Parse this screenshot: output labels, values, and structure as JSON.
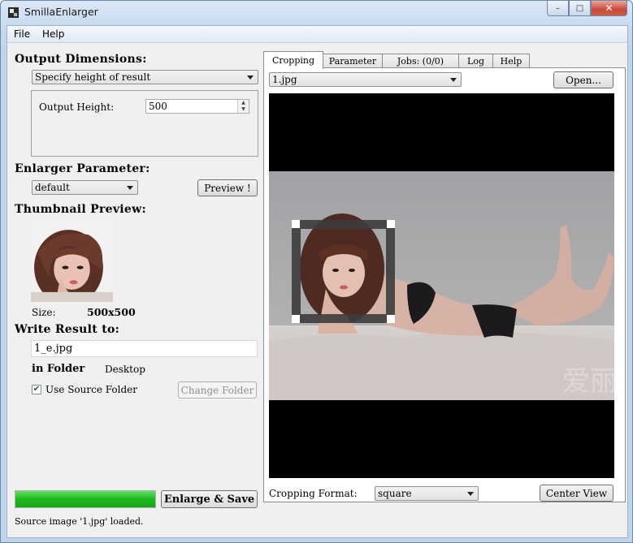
{
  "window": {
    "title": "SmillaEnlarger",
    "min_glyph": "–",
    "max_glyph": "□",
    "close_glyph": "✕"
  },
  "menu": [
    "File",
    "Help"
  ],
  "left": {
    "output_dimensions_label": "Output Dimensions:",
    "dimension_mode": "Specify height of result",
    "output_height_label": "Output Height:",
    "output_height_value": "500",
    "enlarger_parameter_label": "Enlarger Parameter:",
    "parameter_preset": "default",
    "preview_button": "Preview !",
    "thumbnail_label": "Thumbnail Preview:",
    "size_label": "Size:",
    "size_value": "500x500",
    "write_result_label": "Write Result to:",
    "output_filename": "1_e.jpg",
    "in_folder_label": "in Folder",
    "folder_value": "Desktop",
    "use_source_folder_label": "Use Source Folder",
    "use_source_folder_checked": true,
    "change_folder_button": "Change Folder",
    "progress_fraction": 1.0,
    "enlarge_save_button": "Enlarge & Save",
    "status_text": "Source image '1.jpg' loaded."
  },
  "right": {
    "tabs": [
      "Cropping",
      "Parameter",
      "Jobs: (0/0)",
      "Log",
      "Help"
    ],
    "active_tab": "Cropping",
    "source_file": "1.jpg",
    "open_button": "Open...",
    "watermark": "爱丽",
    "cropping_format_label": "Cropping Format:",
    "cropping_format_value": "square",
    "center_view_button": "Center View"
  },
  "colors": {
    "accent_green": "#1fb81f",
    "viewer_background": "#000000"
  }
}
